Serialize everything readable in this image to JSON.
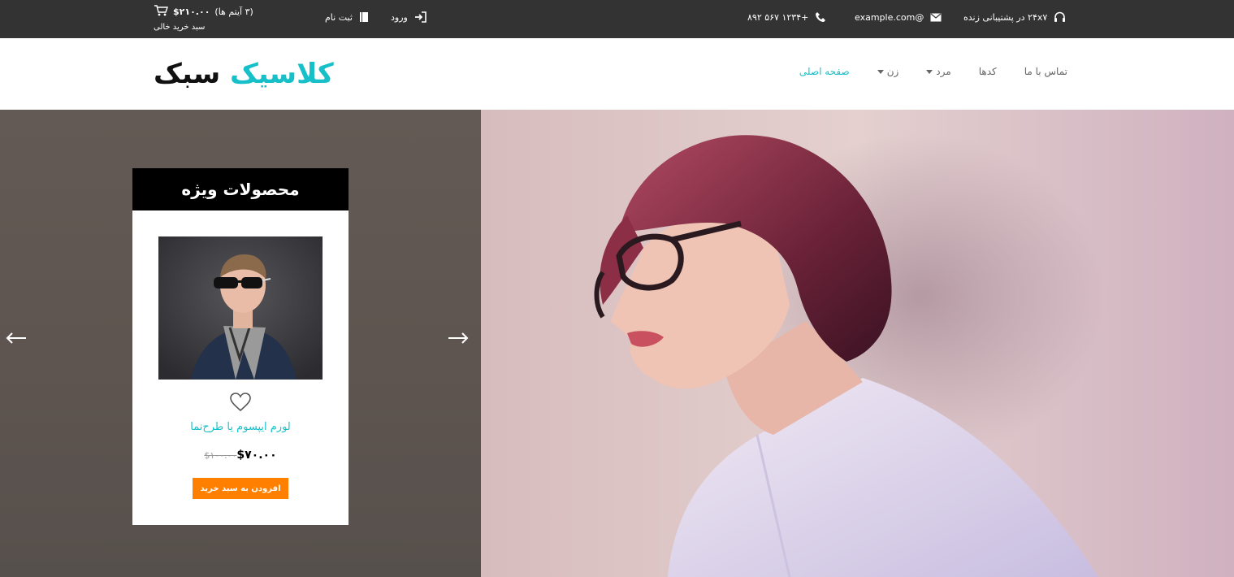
{
  "topbar": {
    "cart_total": "$۲۱۰.۰۰",
    "cart_items": "(۳ آیتم ها)",
    "cart_status": "سبد خرید خالی",
    "register_label": "ثبت نام",
    "login_label": "ورود",
    "phone": "+۱۲۳۴ ۵۶۷ ۸۹۲",
    "email": "@example.com",
    "support": "۲۴x۷ در پشتیبانی زنده"
  },
  "header": {
    "logo_accent": "کلاسیک",
    "logo_dark": "سبک",
    "nav": {
      "home": "صفحه اصلی",
      "women": "زن",
      "men": "مرد",
      "codes": "کدها",
      "contact": "تماس با ما"
    }
  },
  "featured": {
    "heading": "محصولات ویژه",
    "product_title": "لورم ایپسوم یا طرح‌نما",
    "old_price": "$۱۰۰.۰۰",
    "new_price": "$۷۰.۰۰",
    "add_to_cart": "افزودن به سبد خرید"
  },
  "colors": {
    "accent": "#17c0c9",
    "topbar_bg": "#333333",
    "button": "#ff7f00"
  },
  "icons": {
    "cart": "cart-icon",
    "register": "book-icon",
    "login": "sign-in-icon",
    "phone": "phone-icon",
    "email": "envelope-icon",
    "support": "headphones-icon",
    "prev": "arrow-left-icon",
    "next": "arrow-right-icon",
    "wishlist": "heart-icon"
  }
}
